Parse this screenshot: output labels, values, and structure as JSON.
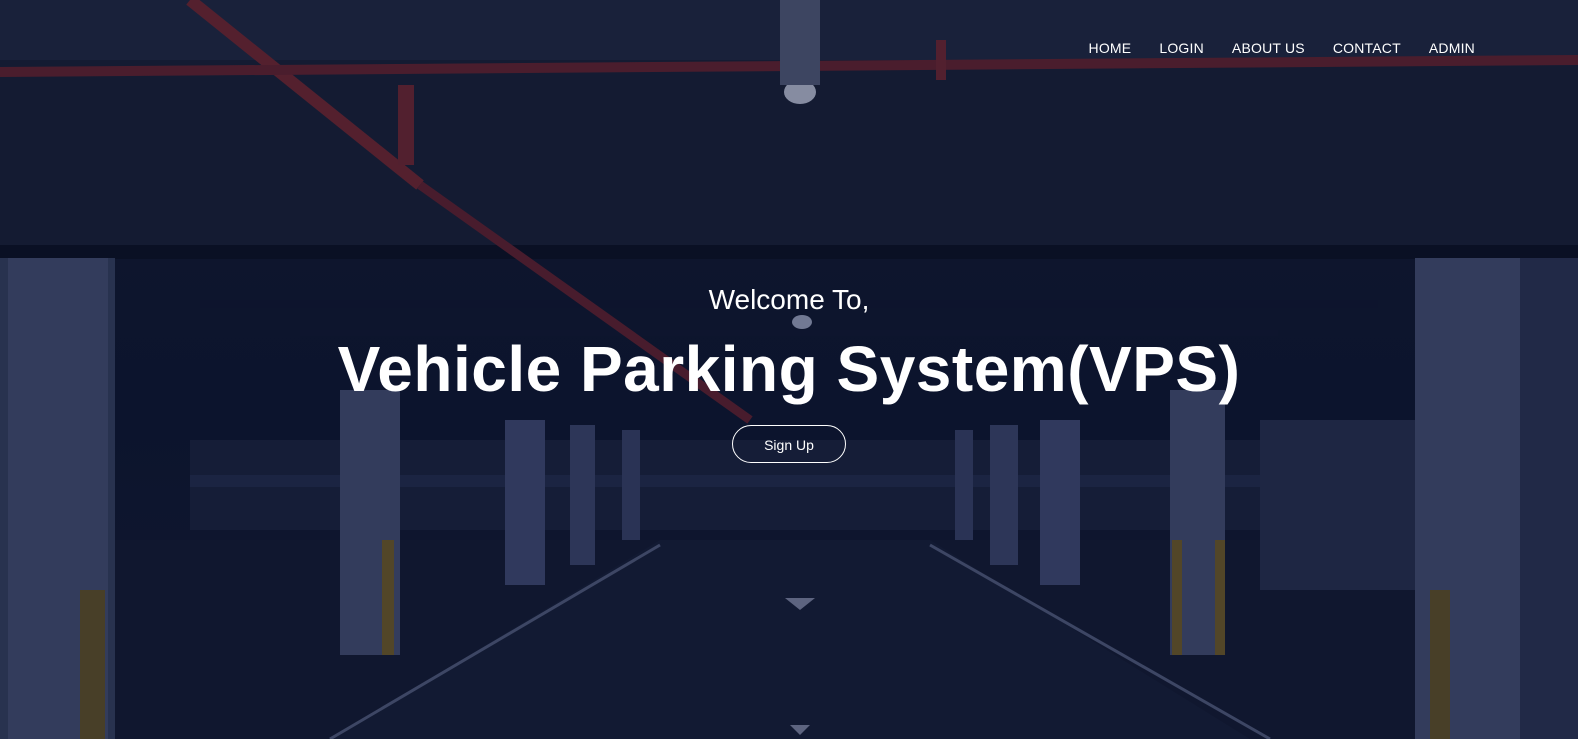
{
  "nav": {
    "items": [
      {
        "label": "HOME"
      },
      {
        "label": "LOGIN"
      },
      {
        "label": "ABOUT US"
      },
      {
        "label": "CONTACT"
      },
      {
        "label": "ADMIN"
      }
    ]
  },
  "hero": {
    "welcome": "Welcome To,",
    "title": "Vehicle Parking System(VPS)",
    "signup_label": "Sign Up"
  },
  "colors": {
    "overlay": "#0d1428",
    "text": "#ffffff",
    "pipe": "#8a2a30"
  }
}
